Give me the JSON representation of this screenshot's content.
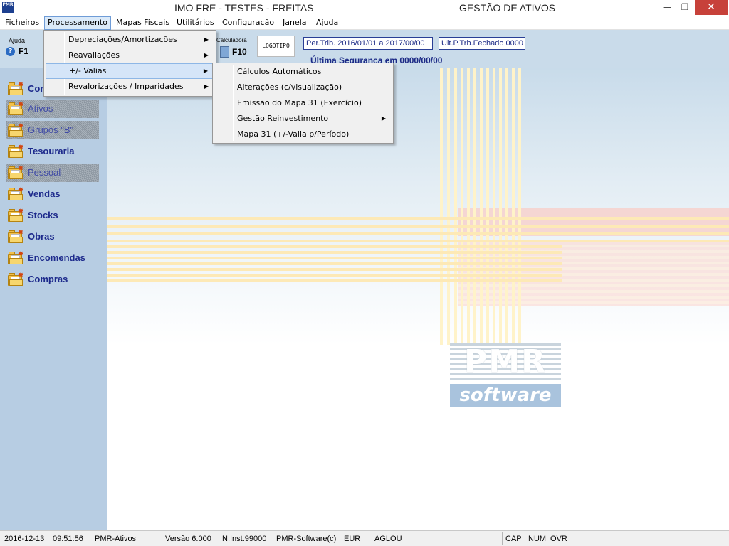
{
  "titlebar": {
    "app_icon_text": "PMR",
    "window_title": "IMO FRE - TESTES - FREITAS",
    "module_title": "GESTÃO DE ATIVOS",
    "minimize_glyph": "—",
    "restore_glyph": "❐",
    "close_glyph": "✕"
  },
  "menubar": {
    "items": [
      "Ficheiros",
      "Processamento",
      "Mapas Fiscais",
      "Utilitários",
      "Configuração",
      "Janela",
      "Ajuda"
    ],
    "active_item": "Processamento"
  },
  "toolbar": {
    "help_label": "Ajuda",
    "help_icon": "?",
    "help_key": "F1",
    "calc_label": "Calculadora",
    "calc_key": "F10",
    "logo_text": "LOGOTIPO",
    "period": "Per.Trib. 2016/01/01 a 2017/00/00",
    "closed_period": "Ult.P.Trb.Fechado 0000",
    "last_backup": "Última Segurança em  0000/00/00"
  },
  "sidebar": {
    "items": [
      {
        "label": "Contabilidade",
        "enabled": true
      },
      {
        "label": "Ativos",
        "enabled": false
      },
      {
        "label": "Grupos \"B\"",
        "enabled": false
      },
      {
        "label": "Tesouraria",
        "enabled": true
      },
      {
        "label": "Pessoal",
        "enabled": false
      },
      {
        "label": "Vendas",
        "enabled": true
      },
      {
        "label": "Stocks",
        "enabled": true
      },
      {
        "label": "Obras",
        "enabled": true
      },
      {
        "label": "Encomendas",
        "enabled": true
      },
      {
        "label": "Compras",
        "enabled": true
      }
    ]
  },
  "processamento_menu": {
    "items": [
      {
        "label": "Depreciações/Amortizações",
        "submenu": true
      },
      {
        "label": "Reavaliações",
        "submenu": true
      },
      {
        "label": "+/- Valias",
        "submenu": true,
        "highlighted": true
      },
      {
        "label": "Revalorizações / Imparidades",
        "submenu": true
      }
    ]
  },
  "valias_submenu": {
    "items": [
      {
        "label": "Cálculos Automáticos",
        "submenu": false
      },
      {
        "label": "Alterações (c/visualização)",
        "submenu": false
      },
      {
        "label": "Emissão do Mapa 31 (Exercício)",
        "submenu": false
      },
      {
        "label": "Gestão Reinvestimento",
        "submenu": true
      },
      {
        "label": "Mapa 31 (+/-Valia p/Período)",
        "submenu": false
      }
    ]
  },
  "brand": {
    "mark": "PMR",
    "word": "software"
  },
  "statusbar": {
    "date": "2016-12-13",
    "time": "09:51:56",
    "module": "PMR-Ativos",
    "version": "Versão  6.000",
    "installation": "N.Inst.99000",
    "company": "PMR-Software(c)",
    "currency": "EUR",
    "user": "AGLOU",
    "caps": "CAP",
    "num": "NUM",
    "ovr": "OVR"
  },
  "colors": {
    "accent_blue": "#1d2a8c",
    "close_red": "#c7413a",
    "sidebar_bg": "#b7cde3",
    "menu_highlight": "#d5e5f8"
  }
}
